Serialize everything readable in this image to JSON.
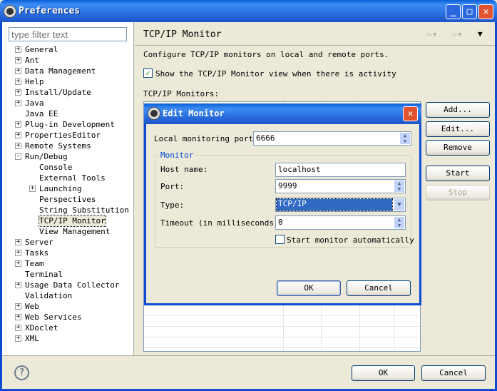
{
  "window": {
    "title": "Preferences"
  },
  "filter": {
    "placeholder": "type filter text"
  },
  "tree": [
    {
      "label": "General",
      "exp": "+",
      "lvl": 0
    },
    {
      "label": "Ant",
      "exp": "+",
      "lvl": 0
    },
    {
      "label": "Data Management",
      "exp": "+",
      "lvl": 0
    },
    {
      "label": "Help",
      "exp": "+",
      "lvl": 0
    },
    {
      "label": "Install/Update",
      "exp": "+",
      "lvl": 0
    },
    {
      "label": "Java",
      "exp": "+",
      "lvl": 0
    },
    {
      "label": "Java EE",
      "exp": "",
      "lvl": 0
    },
    {
      "label": "Plug-in Development",
      "exp": "+",
      "lvl": 0
    },
    {
      "label": "PropertiesEditor",
      "exp": "+",
      "lvl": 0
    },
    {
      "label": "Remote Systems",
      "exp": "+",
      "lvl": 0
    },
    {
      "label": "Run/Debug",
      "exp": "-",
      "lvl": 0
    },
    {
      "label": "Console",
      "exp": "",
      "lvl": 1
    },
    {
      "label": "External Tools",
      "exp": "",
      "lvl": 1
    },
    {
      "label": "Launching",
      "exp": "+",
      "lvl": 1
    },
    {
      "label": "Perspectives",
      "exp": "",
      "lvl": 1
    },
    {
      "label": "String Substitution",
      "exp": "",
      "lvl": 1
    },
    {
      "label": "TCP/IP Monitor",
      "exp": "",
      "lvl": 1,
      "selected": true
    },
    {
      "label": "View Management",
      "exp": "",
      "lvl": 1
    },
    {
      "label": "Server",
      "exp": "+",
      "lvl": 0
    },
    {
      "label": "Tasks",
      "exp": "+",
      "lvl": 0
    },
    {
      "label": "Team",
      "exp": "+",
      "lvl": 0
    },
    {
      "label": "Terminal",
      "exp": "",
      "lvl": 0
    },
    {
      "label": "Usage Data Collector",
      "exp": "+",
      "lvl": 0
    },
    {
      "label": "Validation",
      "exp": "",
      "lvl": 0
    },
    {
      "label": "Web",
      "exp": "+",
      "lvl": 0
    },
    {
      "label": "Web Services",
      "exp": "+",
      "lvl": 0
    },
    {
      "label": "XDoclet",
      "exp": "+",
      "lvl": 0
    },
    {
      "label": "XML",
      "exp": "+",
      "lvl": 0
    }
  ],
  "page": {
    "title": "TCP/IP Monitor",
    "description": "Configure TCP/IP monitors on local and remote ports.",
    "show_view_label": "Show the TCP/IP Monitor view when there is activity",
    "show_view_checked": true,
    "monitors_label": "TCP/IP Monitors:"
  },
  "side_buttons": {
    "add": "Add...",
    "edit": "Edit...",
    "remove": "Remove",
    "start": "Start",
    "stop": "Stop"
  },
  "dialog": {
    "title": "Edit Monitor",
    "local_port_label": "Local monitoring port:",
    "local_port": "6666",
    "group": "Monitor",
    "host_label": "Host name:",
    "host": "localhost",
    "port_label": "Port:",
    "port": "9999",
    "type_label": "Type:",
    "type": "TCP/IP",
    "timeout_label": "Timeout (in milliseconds):",
    "timeout": "0",
    "auto_start_label": "Start monitor automatically",
    "auto_start_checked": false,
    "ok": "OK",
    "cancel": "Cancel"
  },
  "footer": {
    "ok": "OK",
    "cancel": "Cancel"
  }
}
